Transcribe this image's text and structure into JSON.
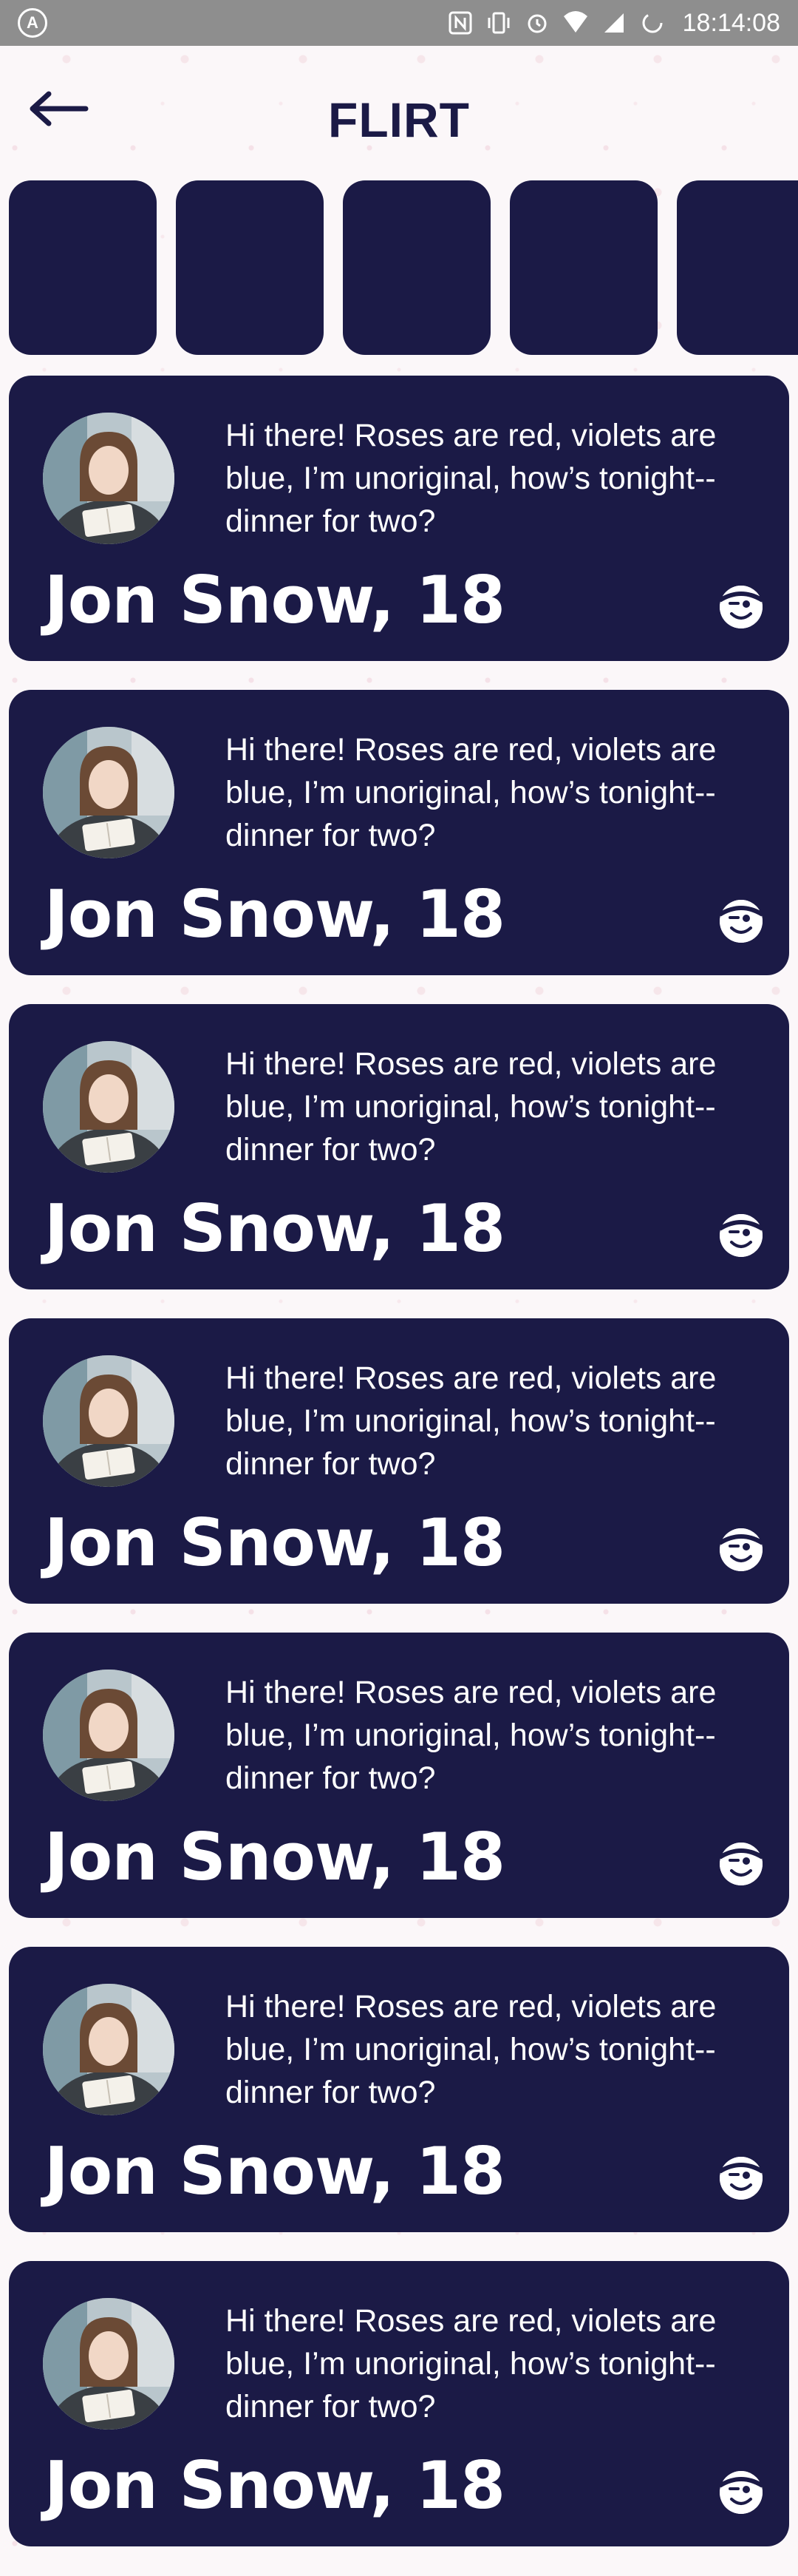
{
  "status_bar": {
    "logo": "A",
    "time": "18:14:08",
    "icons": [
      "nfc-icon",
      "vibrate-icon",
      "alarm-icon",
      "wifi-icon",
      "signal-icon",
      "battery-icon"
    ]
  },
  "header": {
    "title": "FLIRT",
    "back_icon": "arrow-left-icon"
  },
  "stories": [
    {
      "id": 1
    },
    {
      "id": 2
    },
    {
      "id": 3
    },
    {
      "id": 4
    },
    {
      "id": 5
    }
  ],
  "cards": [
    {
      "name": "Jon Snow, 18",
      "message": "Hi there! Roses are red, violets are blue, I’m unoriginal, how’s tonight--dinner for two?"
    },
    {
      "name": "Jon Snow, 18",
      "message": "Hi there! Roses are red, violets are blue, I’m unoriginal, how’s tonight--dinner for two?"
    },
    {
      "name": "Jon Snow, 18",
      "message": "Hi there! Roses are red, violets are blue, I’m unoriginal, how’s tonight--dinner for two?"
    },
    {
      "name": "Jon Snow, 18",
      "message": "Hi there! Roses are red, violets are blue, I’m unoriginal, how’s tonight--dinner for two?"
    },
    {
      "name": "Jon Snow, 18",
      "message": "Hi there! Roses are red, violets are blue, I’m unoriginal, how’s tonight--dinner for two?"
    },
    {
      "name": "Jon Snow, 18",
      "message": "Hi there! Roses are red, violets are blue, I’m unoriginal, how’s tonight--dinner for two?"
    },
    {
      "name": "Jon Snow, 18",
      "message": "Hi there! Roses are red, violets are blue, I’m unoriginal, how’s tonight--dinner for two?"
    }
  ],
  "colors": {
    "primary": "#1b1a46",
    "text_on_primary": "#ffffff",
    "status_bar": "#8e8e8e",
    "background": "#fbf7f9"
  }
}
